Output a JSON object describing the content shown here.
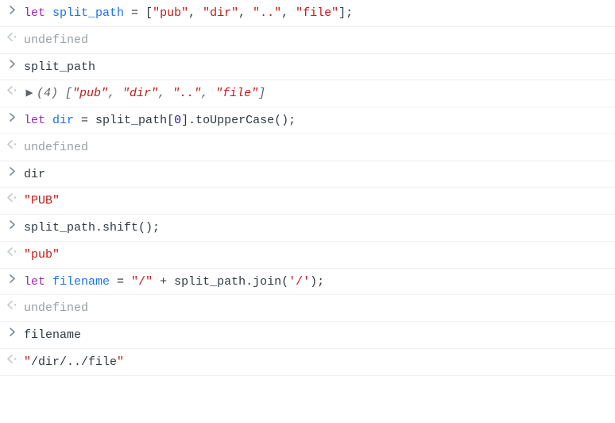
{
  "lines": [
    {
      "kind": "input",
      "spans": [
        {
          "cls": "tok-keyword",
          "t": "let"
        },
        {
          "cls": "tok-plain",
          "t": " "
        },
        {
          "cls": "tok-var",
          "t": "split_path"
        },
        {
          "cls": "tok-plain",
          "t": " = ["
        },
        {
          "cls": "tok-str",
          "t": "\"pub\""
        },
        {
          "cls": "tok-plain",
          "t": ", "
        },
        {
          "cls": "tok-str",
          "t": "\"dir\""
        },
        {
          "cls": "tok-plain",
          "t": ", "
        },
        {
          "cls": "tok-str",
          "t": "\"..\""
        },
        {
          "cls": "tok-plain",
          "t": ", "
        },
        {
          "cls": "tok-str",
          "t": "\"file\""
        },
        {
          "cls": "tok-plain",
          "t": "];"
        }
      ]
    },
    {
      "kind": "result",
      "spans": [
        {
          "cls": "undef",
          "t": "undefined"
        }
      ]
    },
    {
      "kind": "input",
      "spans": [
        {
          "cls": "tok-plain",
          "t": "split_path"
        }
      ]
    },
    {
      "kind": "result_expand",
      "disclosure": "▶",
      "spans": [
        {
          "cls": "italic-dim",
          "t": "(4) ["
        },
        {
          "cls": "italic-str",
          "t": "\"pub\""
        },
        {
          "cls": "italic-dim",
          "t": ", "
        },
        {
          "cls": "italic-str",
          "t": "\"dir\""
        },
        {
          "cls": "italic-dim",
          "t": ", "
        },
        {
          "cls": "italic-str",
          "t": "\"..\""
        },
        {
          "cls": "italic-dim",
          "t": ", "
        },
        {
          "cls": "italic-str",
          "t": "\"file\""
        },
        {
          "cls": "italic-dim",
          "t": "]"
        }
      ]
    },
    {
      "kind": "input",
      "spans": [
        {
          "cls": "tok-keyword",
          "t": "let"
        },
        {
          "cls": "tok-plain",
          "t": " "
        },
        {
          "cls": "tok-var",
          "t": "dir"
        },
        {
          "cls": "tok-plain",
          "t": " = split_path["
        },
        {
          "cls": "tok-num",
          "t": "0"
        },
        {
          "cls": "tok-plain",
          "t": "].toUpperCase();"
        }
      ]
    },
    {
      "kind": "result",
      "spans": [
        {
          "cls": "undef",
          "t": "undefined"
        }
      ]
    },
    {
      "kind": "input",
      "spans": [
        {
          "cls": "tok-plain",
          "t": "dir"
        }
      ]
    },
    {
      "kind": "result",
      "spans": [
        {
          "cls": "tok-str",
          "t": "\"PUB\""
        }
      ]
    },
    {
      "kind": "input",
      "spans": [
        {
          "cls": "tok-plain",
          "t": "split_path.shift();"
        }
      ]
    },
    {
      "kind": "result",
      "spans": [
        {
          "cls": "tok-str",
          "t": "\"pub\""
        }
      ]
    },
    {
      "kind": "input",
      "spans": [
        {
          "cls": "tok-keyword",
          "t": "let"
        },
        {
          "cls": "tok-plain",
          "t": " "
        },
        {
          "cls": "tok-var",
          "t": "filename"
        },
        {
          "cls": "tok-plain",
          "t": " = "
        },
        {
          "cls": "tok-str",
          "t": "\"/\""
        },
        {
          "cls": "tok-plain",
          "t": " + split_path.join("
        },
        {
          "cls": "tok-str",
          "t": "'/'"
        },
        {
          "cls": "tok-plain",
          "t": ");"
        }
      ]
    },
    {
      "kind": "result",
      "spans": [
        {
          "cls": "undef",
          "t": "undefined"
        }
      ]
    },
    {
      "kind": "input",
      "spans": [
        {
          "cls": "tok-plain",
          "t": "filename"
        }
      ]
    },
    {
      "kind": "result",
      "spans": [
        {
          "cls": "tok-str",
          "t": "\""
        },
        {
          "cls": "tok-plain",
          "t": "/dir/../file"
        },
        {
          "cls": "tok-str",
          "t": "\""
        }
      ]
    }
  ]
}
